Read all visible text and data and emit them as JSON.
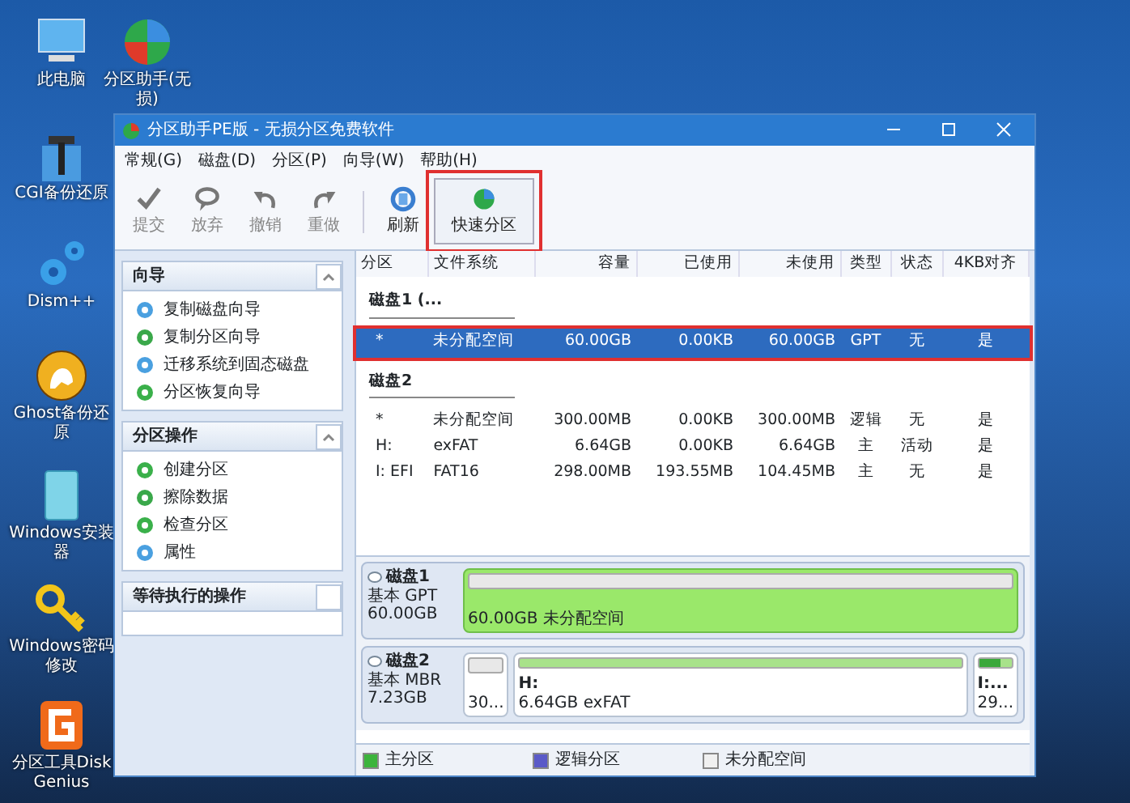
{
  "desktop_icons": [
    {
      "label": "此电脑",
      "kind": "pc"
    },
    {
      "label": "分区助手(无损)",
      "kind": "partition"
    },
    {
      "label": "CGI备份还原",
      "kind": "cgi"
    },
    {
      "label": "Dism++",
      "kind": "dism"
    },
    {
      "label": "Ghost备份还原",
      "kind": "ghost"
    },
    {
      "label": "Windows安装器",
      "kind": "installer"
    },
    {
      "label": "Windows密码修改",
      "kind": "key"
    },
    {
      "label": "分区工具DiskGenius",
      "kind": "diskgenius"
    }
  ],
  "window": {
    "title": "分区助手PE版 - 无损分区免费软件",
    "menu": [
      "常规(G)",
      "磁盘(D)",
      "分区(P)",
      "向导(W)",
      "帮助(H)"
    ],
    "toolbar": [
      {
        "label": "提交",
        "kind": "check",
        "disabled": true,
        "highlighted": false
      },
      {
        "label": "放弃",
        "kind": "discard",
        "disabled": true,
        "highlighted": false
      },
      {
        "label": "撤销",
        "kind": "undo",
        "disabled": true,
        "highlighted": false
      },
      {
        "label": "重做",
        "kind": "redo",
        "disabled": true,
        "highlighted": false
      },
      {
        "label": "刷新",
        "kind": "refresh",
        "disabled": false,
        "highlighted": false
      },
      {
        "label": "快速分区",
        "kind": "quick",
        "disabled": false,
        "highlighted": true
      }
    ],
    "panels": [
      {
        "title": "向导",
        "collapsible": true,
        "items": [
          {
            "label": "复制磁盘向导",
            "kind": "disk"
          },
          {
            "label": "复制分区向导",
            "kind": "copy"
          },
          {
            "label": "迁移系统到固态磁盘",
            "kind": "disk"
          },
          {
            "label": "分区恢复向导",
            "kind": "ok"
          }
        ]
      },
      {
        "title": "分区操作",
        "collapsible": true,
        "items": [
          {
            "label": "创建分区",
            "kind": "ok"
          },
          {
            "label": "擦除数据",
            "kind": "copy"
          },
          {
            "label": "检查分区",
            "kind": "ok"
          },
          {
            "label": "属性",
            "kind": "disk"
          }
        ]
      },
      {
        "title": "等待执行的操作",
        "collapsible": false
      }
    ],
    "table": {
      "columns": [
        "分区",
        "文件系统",
        "容量",
        "已使用",
        "未使用",
        "类型",
        "状态",
        "4KB对齐"
      ],
      "groups": [
        {
          "name": "磁盘1 (...",
          "rows": [
            {
              "cells": [
                "*",
                "未分配空间",
                "60.00GB",
                "0.00KB",
                "60.00GB",
                "GPT",
                "无",
                "是"
              ],
              "selected": true,
              "highlighted": true
            }
          ]
        },
        {
          "name": "磁盘2",
          "rows": [
            {
              "cells": [
                "*",
                "未分配空间",
                "300.00MB",
                "0.00KB",
                "300.00MB",
                "逻辑",
                "无",
                "是"
              ],
              "selected": false,
              "highlighted": false
            },
            {
              "cells": [
                "H:",
                "exFAT",
                "6.64GB",
                "0.00KB",
                "6.64GB",
                "主",
                "活动",
                "是"
              ],
              "selected": false,
              "highlighted": false
            },
            {
              "cells": [
                "I: EFI",
                "FAT16",
                "298.00MB",
                "193.55MB",
                "104.45MB",
                "主",
                "无",
                "是"
              ],
              "selected": false,
              "highlighted": false
            }
          ]
        }
      ]
    },
    "disk_map": [
      {
        "name": "磁盘1",
        "type": "基本 GPT",
        "size": "60.00GB",
        "partitions": [
          {
            "detail": "60.00GB 未分配空间",
            "kind": "unallocated",
            "level": 0,
            "selected": true
          }
        ]
      },
      {
        "name": "磁盘2",
        "type": "基本 MBR",
        "size": "7.23GB",
        "partitions": [
          {
            "detail": "30...",
            "kind": "unallocated",
            "level": 0,
            "selected": false
          },
          {
            "label": "H:",
            "detail": "6.64GB exFAT",
            "kind": "primary",
            "level": 0,
            "selected": false
          },
          {
            "label": "I:...",
            "detail": "29...",
            "kind": "primary",
            "level": 0.65,
            "selected": false
          }
        ]
      }
    ],
    "legend": [
      {
        "label": "主分区",
        "color": "#3cb43c"
      },
      {
        "label": "逻辑分区",
        "color": "#5a5ac8"
      },
      {
        "label": "未分配空间",
        "color": "#f0f0f0"
      }
    ]
  }
}
